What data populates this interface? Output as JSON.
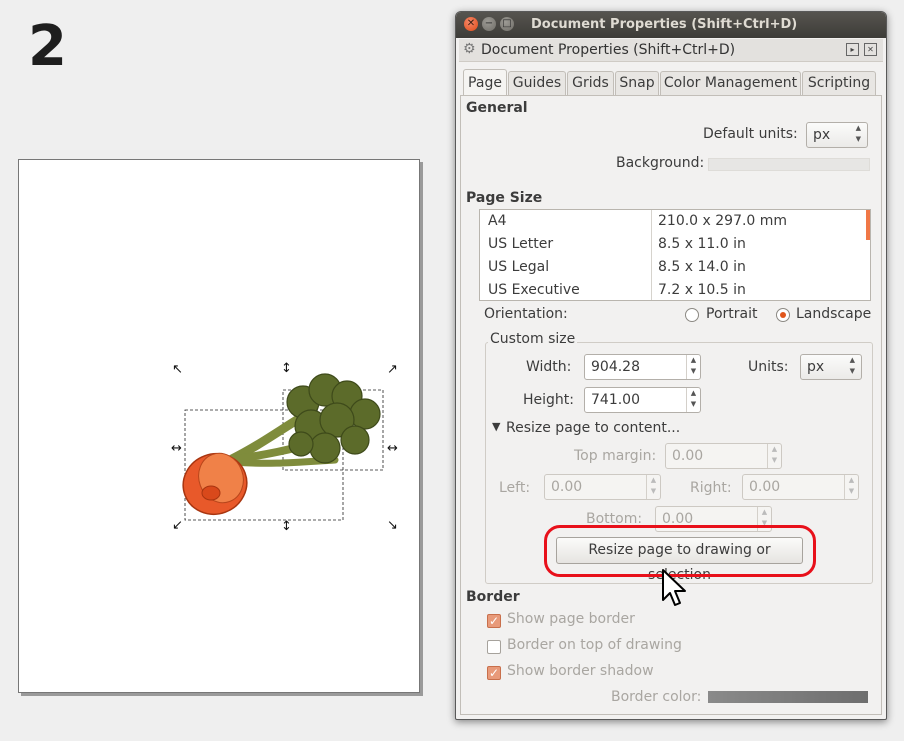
{
  "step_number": "2",
  "window": {
    "title": "Document Properties (Shift+Ctrl+D)",
    "dock_title": "Document Properties (Shift+Ctrl+D)",
    "close_icon": "close-icon",
    "minimize_icon": "minimize-icon",
    "maximize_icon": "maximize-icon"
  },
  "tabs": [
    {
      "label": "Page",
      "active": true
    },
    {
      "label": "Guides"
    },
    {
      "label": "Grids"
    },
    {
      "label": "Snap"
    },
    {
      "label": "Color Management"
    },
    {
      "label": "Scripting"
    }
  ],
  "general": {
    "heading": "General",
    "default_units_label": "Default units:",
    "default_units_value": "px",
    "background_label": "Background:",
    "background_color": "#e7e6e4"
  },
  "page_size": {
    "heading": "Page Size",
    "rows": [
      {
        "name": "A4",
        "size": "210.0 x 297.0 mm"
      },
      {
        "name": "US Letter",
        "size": "8.5 x 11.0 in"
      },
      {
        "name": "US Legal",
        "size": "8.5 x 14.0 in"
      },
      {
        "name": "US Executive",
        "size": "7.2 x 10.5 in"
      }
    ],
    "orientation_label": "Orientation:",
    "portrait_label": "Portrait",
    "landscape_label": "Landscape",
    "orientation_selected": "Landscape"
  },
  "custom_size": {
    "heading": "Custom size",
    "width_label": "Width:",
    "width_value": "904.28",
    "height_label": "Height:",
    "height_value": "741.00",
    "units_label": "Units:",
    "units_value": "px"
  },
  "resize": {
    "expander_label": "Resize page to content...",
    "top_margin_label": "Top margin:",
    "top_margin_value": "0.00",
    "left_label": "Left:",
    "left_value": "0.00",
    "right_label": "Right:",
    "right_value": "0.00",
    "bottom_label": "Bottom:",
    "bottom_value": "0.00",
    "button_label": "Resize page to drawing or selection",
    "highlight_color": "#e8101a"
  },
  "border": {
    "heading": "Border",
    "show_page_border_label": "Show page border",
    "show_page_border": true,
    "border_on_top_label": "Border on top of drawing",
    "border_on_top": false,
    "show_shadow_label": "Show border shadow",
    "show_shadow": true,
    "border_color_label": "Border color:"
  },
  "colors": {
    "accent": "#e1561c",
    "carrot": "#e8592a",
    "broccoli": "#5c6b2a"
  }
}
